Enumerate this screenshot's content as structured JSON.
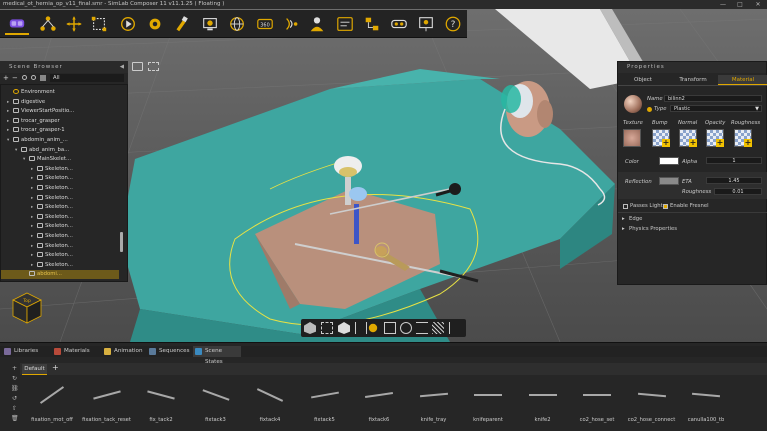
{
  "window": {
    "title": "medical_ot_hernia_op_v11_final.smr - SimLab Composer 11 v11.1.25 ( Floating )",
    "minimize": "—",
    "maximize": "□",
    "close": "✕"
  },
  "toolbar": {
    "items": [
      {
        "name": "vr-headset-icon",
        "active": true
      },
      {
        "name": "scene-nodes-icon"
      },
      {
        "name": "move-tool-icon"
      },
      {
        "name": "bounding-box-icon"
      },
      {
        "name": "animation-icon"
      },
      {
        "name": "simulation-icon"
      },
      {
        "name": "paint-brush-icon"
      },
      {
        "name": "render-icon"
      },
      {
        "name": "globe-icon"
      },
      {
        "name": "panorama-360-icon"
      },
      {
        "name": "sensor-icon"
      },
      {
        "name": "user-avatar-icon"
      },
      {
        "name": "workflow-icon"
      },
      {
        "name": "diagram-icon"
      },
      {
        "name": "vr-viewer-icon"
      },
      {
        "name": "presentation-icon"
      },
      {
        "name": "help-icon"
      }
    ],
    "panorama_label": "360",
    "help_label": "?"
  },
  "scene_browser": {
    "title": "Scene Browser",
    "filter_value": "All",
    "add_label": "+",
    "remove_label": "−",
    "tree": [
      {
        "label": "Environment",
        "depth": 0,
        "toggle": ""
      },
      {
        "label": "digestive",
        "depth": 0,
        "toggle": "▸"
      },
      {
        "label": "ViewerStartPositio...",
        "depth": 0,
        "toggle": "▸"
      },
      {
        "label": "trocar_grasper",
        "depth": 0,
        "toggle": "▸"
      },
      {
        "label": "trocar_grasper-1",
        "depth": 0,
        "toggle": "▸"
      },
      {
        "label": "abdomin_anim_...",
        "depth": 0,
        "toggle": "▾"
      },
      {
        "label": "abd_anim_ba...",
        "depth": 1,
        "toggle": "▾"
      },
      {
        "label": "MainSkelet...",
        "depth": 2,
        "toggle": "▾"
      },
      {
        "label": "Skeleton...",
        "depth": 3,
        "toggle": "▸"
      },
      {
        "label": "Skeleton...",
        "depth": 3,
        "toggle": "▸"
      },
      {
        "label": "Skeleton...",
        "depth": 3,
        "toggle": "▸"
      },
      {
        "label": "Skeleton...",
        "depth": 3,
        "toggle": "▸"
      },
      {
        "label": "Skeleton...",
        "depth": 3,
        "toggle": "▸"
      },
      {
        "label": "Skeleton...",
        "depth": 3,
        "toggle": "▸"
      },
      {
        "label": "Skeleton...",
        "depth": 3,
        "toggle": "▸"
      },
      {
        "label": "Skeleton...",
        "depth": 3,
        "toggle": "▸"
      },
      {
        "label": "Skeleton...",
        "depth": 3,
        "toggle": "▸"
      },
      {
        "label": "Skeleton...",
        "depth": 3,
        "toggle": "▸"
      },
      {
        "label": "Skeleton...",
        "depth": 3,
        "toggle": "▸"
      },
      {
        "label": "abdomi...",
        "depth": 2,
        "toggle": "",
        "selected": true
      }
    ]
  },
  "properties": {
    "title": "Properties",
    "tabs": [
      "Object",
      "Transform",
      "Material"
    ],
    "active_tab": "Material",
    "name_label": "Name",
    "name_value": "bilinn2",
    "type_label": "Type",
    "type_value": "Plastic",
    "texture_headers": [
      "Texture",
      "Bump",
      "Normal",
      "Opacity",
      "Roughness"
    ],
    "color_label": "Color",
    "alpha_label": "Alpha",
    "alpha_value": "1",
    "reflection_label": "Reflection",
    "eta_label": "ETA",
    "eta_value": "1.45",
    "roughness_label": "Roughness",
    "roughness_value": "0.01",
    "passes_light_label": "Passes Light",
    "enable_fresnel_label": "Enable Fresnel",
    "edge_label": "Edge",
    "physics_label": "Physics Properties",
    "color_value": "#ffffff",
    "reflection_color": "#8a8a8a"
  },
  "bottom": {
    "tabs": [
      {
        "label": "Libraries",
        "color": "#7a6a9a"
      },
      {
        "label": "Materials",
        "color": "#b84a3a"
      },
      {
        "label": "Animation",
        "color": "#d8b040"
      },
      {
        "label": "Sequences",
        "color": "#5a7a9a"
      },
      {
        "label": "Scene States",
        "color": "#3a8ac0"
      }
    ],
    "active_tab": "Scene States",
    "default_tab": "Default",
    "add_state": "+",
    "states": [
      "fixation_mot_off",
      "fixation_tack_reset",
      "fix_tack2",
      "fixtack3",
      "fixtack4",
      "fixtack5",
      "fixtack6",
      "knife_tray",
      "knifeparent",
      "knife2",
      "co2_hose_set",
      "co2_hose_connect",
      "canulla100_tb"
    ]
  },
  "nav_cube": {
    "label": "Top"
  },
  "colors": {
    "accent": "#e0a800",
    "drape": "#3fa7a1",
    "panel": "#262626"
  }
}
